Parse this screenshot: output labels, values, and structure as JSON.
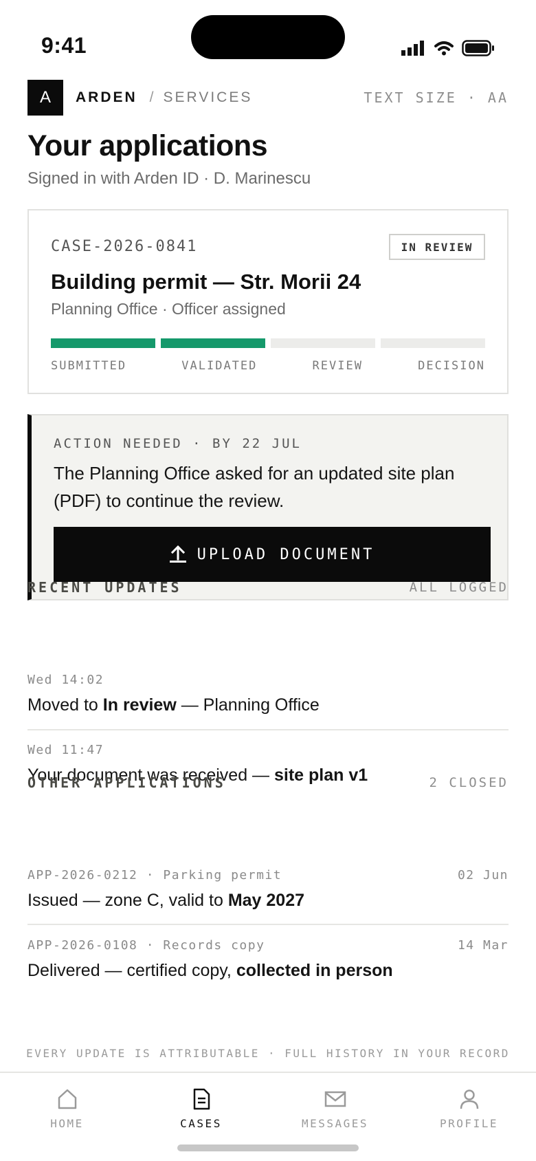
{
  "status_bar": {
    "time": "9:41"
  },
  "header": {
    "logo_letter": "A",
    "brand": "ARDEN",
    "separator": "/",
    "section": "SERVICES",
    "text_size": "TEXT SIZE · AA"
  },
  "page": {
    "title": "Your applications",
    "subtitle": "Signed in with Arden ID · D. Marinescu"
  },
  "case": {
    "id": "CASE-2026-0841",
    "status": "IN REVIEW",
    "title": "Building permit — Str. Morii 24",
    "meta": "Planning Office · Officer assigned",
    "steps": [
      "SUBMITTED",
      "VALIDATED",
      "REVIEW",
      "DECISION"
    ],
    "completed_steps": 2,
    "colors": {
      "progress_done": "#15996b",
      "progress_pending": "#ececea"
    }
  },
  "action": {
    "label": "ACTION NEEDED · BY 22 JUL",
    "text": "The Planning Office asked for an updated site plan (PDF) to continue the review.",
    "button_label": "UPLOAD DOCUMENT",
    "button_icon": "upload-icon"
  },
  "recent_updates": {
    "title": "RECENT UPDATES",
    "link": "ALL LOGGED",
    "items": [
      {
        "time": "Wed 14:02",
        "pre": "Moved to ",
        "bold": "In review",
        "post": " — Planning Office"
      },
      {
        "time": "Wed 11:47",
        "pre": "Your document was received — ",
        "bold": "site plan v1",
        "post": ""
      }
    ]
  },
  "other_applications": {
    "title": "OTHER APPLICATIONS",
    "link": "2 CLOSED",
    "items": [
      {
        "ref": "APP-2026-0212 · Parking permit",
        "date": "02 Jun",
        "pre": "Issued — zone C, valid to ",
        "bold": "May 2027"
      },
      {
        "ref": "APP-2026-0108 · Records copy",
        "date": "14 Mar",
        "pre": "Delivered — certified copy, ",
        "bold": "collected in person"
      }
    ]
  },
  "footer_note": "EVERY UPDATE IS ATTRIBUTABLE · FULL HISTORY IN YOUR RECORD",
  "tabs": [
    {
      "label": "HOME",
      "icon": "home-icon"
    },
    {
      "label": "CASES",
      "icon": "document-icon",
      "active": true
    },
    {
      "label": "MESSAGES",
      "icon": "mail-icon"
    },
    {
      "label": "PROFILE",
      "icon": "person-icon"
    }
  ]
}
